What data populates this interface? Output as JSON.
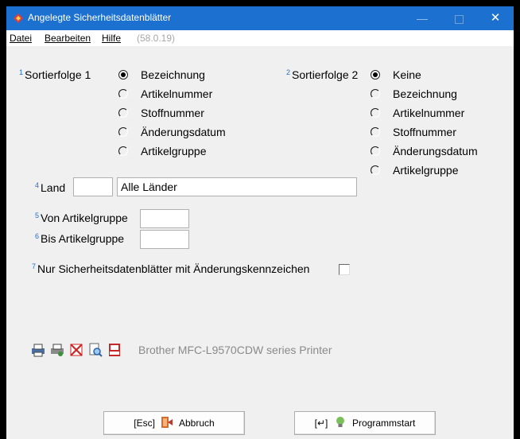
{
  "window": {
    "title": "Angelegte Sicherheitsdatenblätter",
    "close_glyph": "✕",
    "min_glyph": "—"
  },
  "menu": {
    "items": [
      "Datei",
      "Bearbeiten",
      "Hilfe"
    ],
    "version": "(58.0.19)"
  },
  "sort1": {
    "number": "1",
    "label": "Sortierfolge 1",
    "options": [
      "Bezeichnung",
      "Artikelnummer",
      "Stoffnummer",
      "Änderungsdatum",
      "Artikelgruppe"
    ],
    "selected": 0
  },
  "sort2": {
    "number": "2",
    "label": "Sortierfolge 2",
    "options": [
      "Keine",
      "Bezeichnung",
      "Artikelnummer",
      "Stoffnummer",
      "Änderungsdatum",
      "Artikelgruppe"
    ],
    "selected": 0
  },
  "land": {
    "number": "4",
    "label": "Land",
    "code_value": "",
    "name_value": "Alle Länder"
  },
  "von_artikelgruppe": {
    "number": "5",
    "label": "Von Artikelgruppe",
    "value": ""
  },
  "bis_artikelgruppe": {
    "number": "6",
    "label": "Bis Artikelgruppe",
    "value": ""
  },
  "aenderung": {
    "number": "7",
    "label": "Nur Sicherheitsdatenblätter mit Änderungskennzeichen",
    "checked": false
  },
  "printer": {
    "icons": [
      "print-icon",
      "print-setup-icon",
      "no-print-icon",
      "preview-icon",
      "pdf-icon"
    ],
    "name": "Brother MFC-L9570CDW series Printer"
  },
  "buttons": {
    "abbruch": {
      "key": "[Esc]",
      "label": "Abbruch",
      "icon": "cancel-exit-icon"
    },
    "start": {
      "key": "[↵]",
      "label": "Programmstart",
      "icon": "lightbulb-icon"
    }
  },
  "colors": {
    "titlebar": "#1b70d0",
    "background": "#f0f0f0",
    "disabled_text": "#8a8a8a"
  }
}
